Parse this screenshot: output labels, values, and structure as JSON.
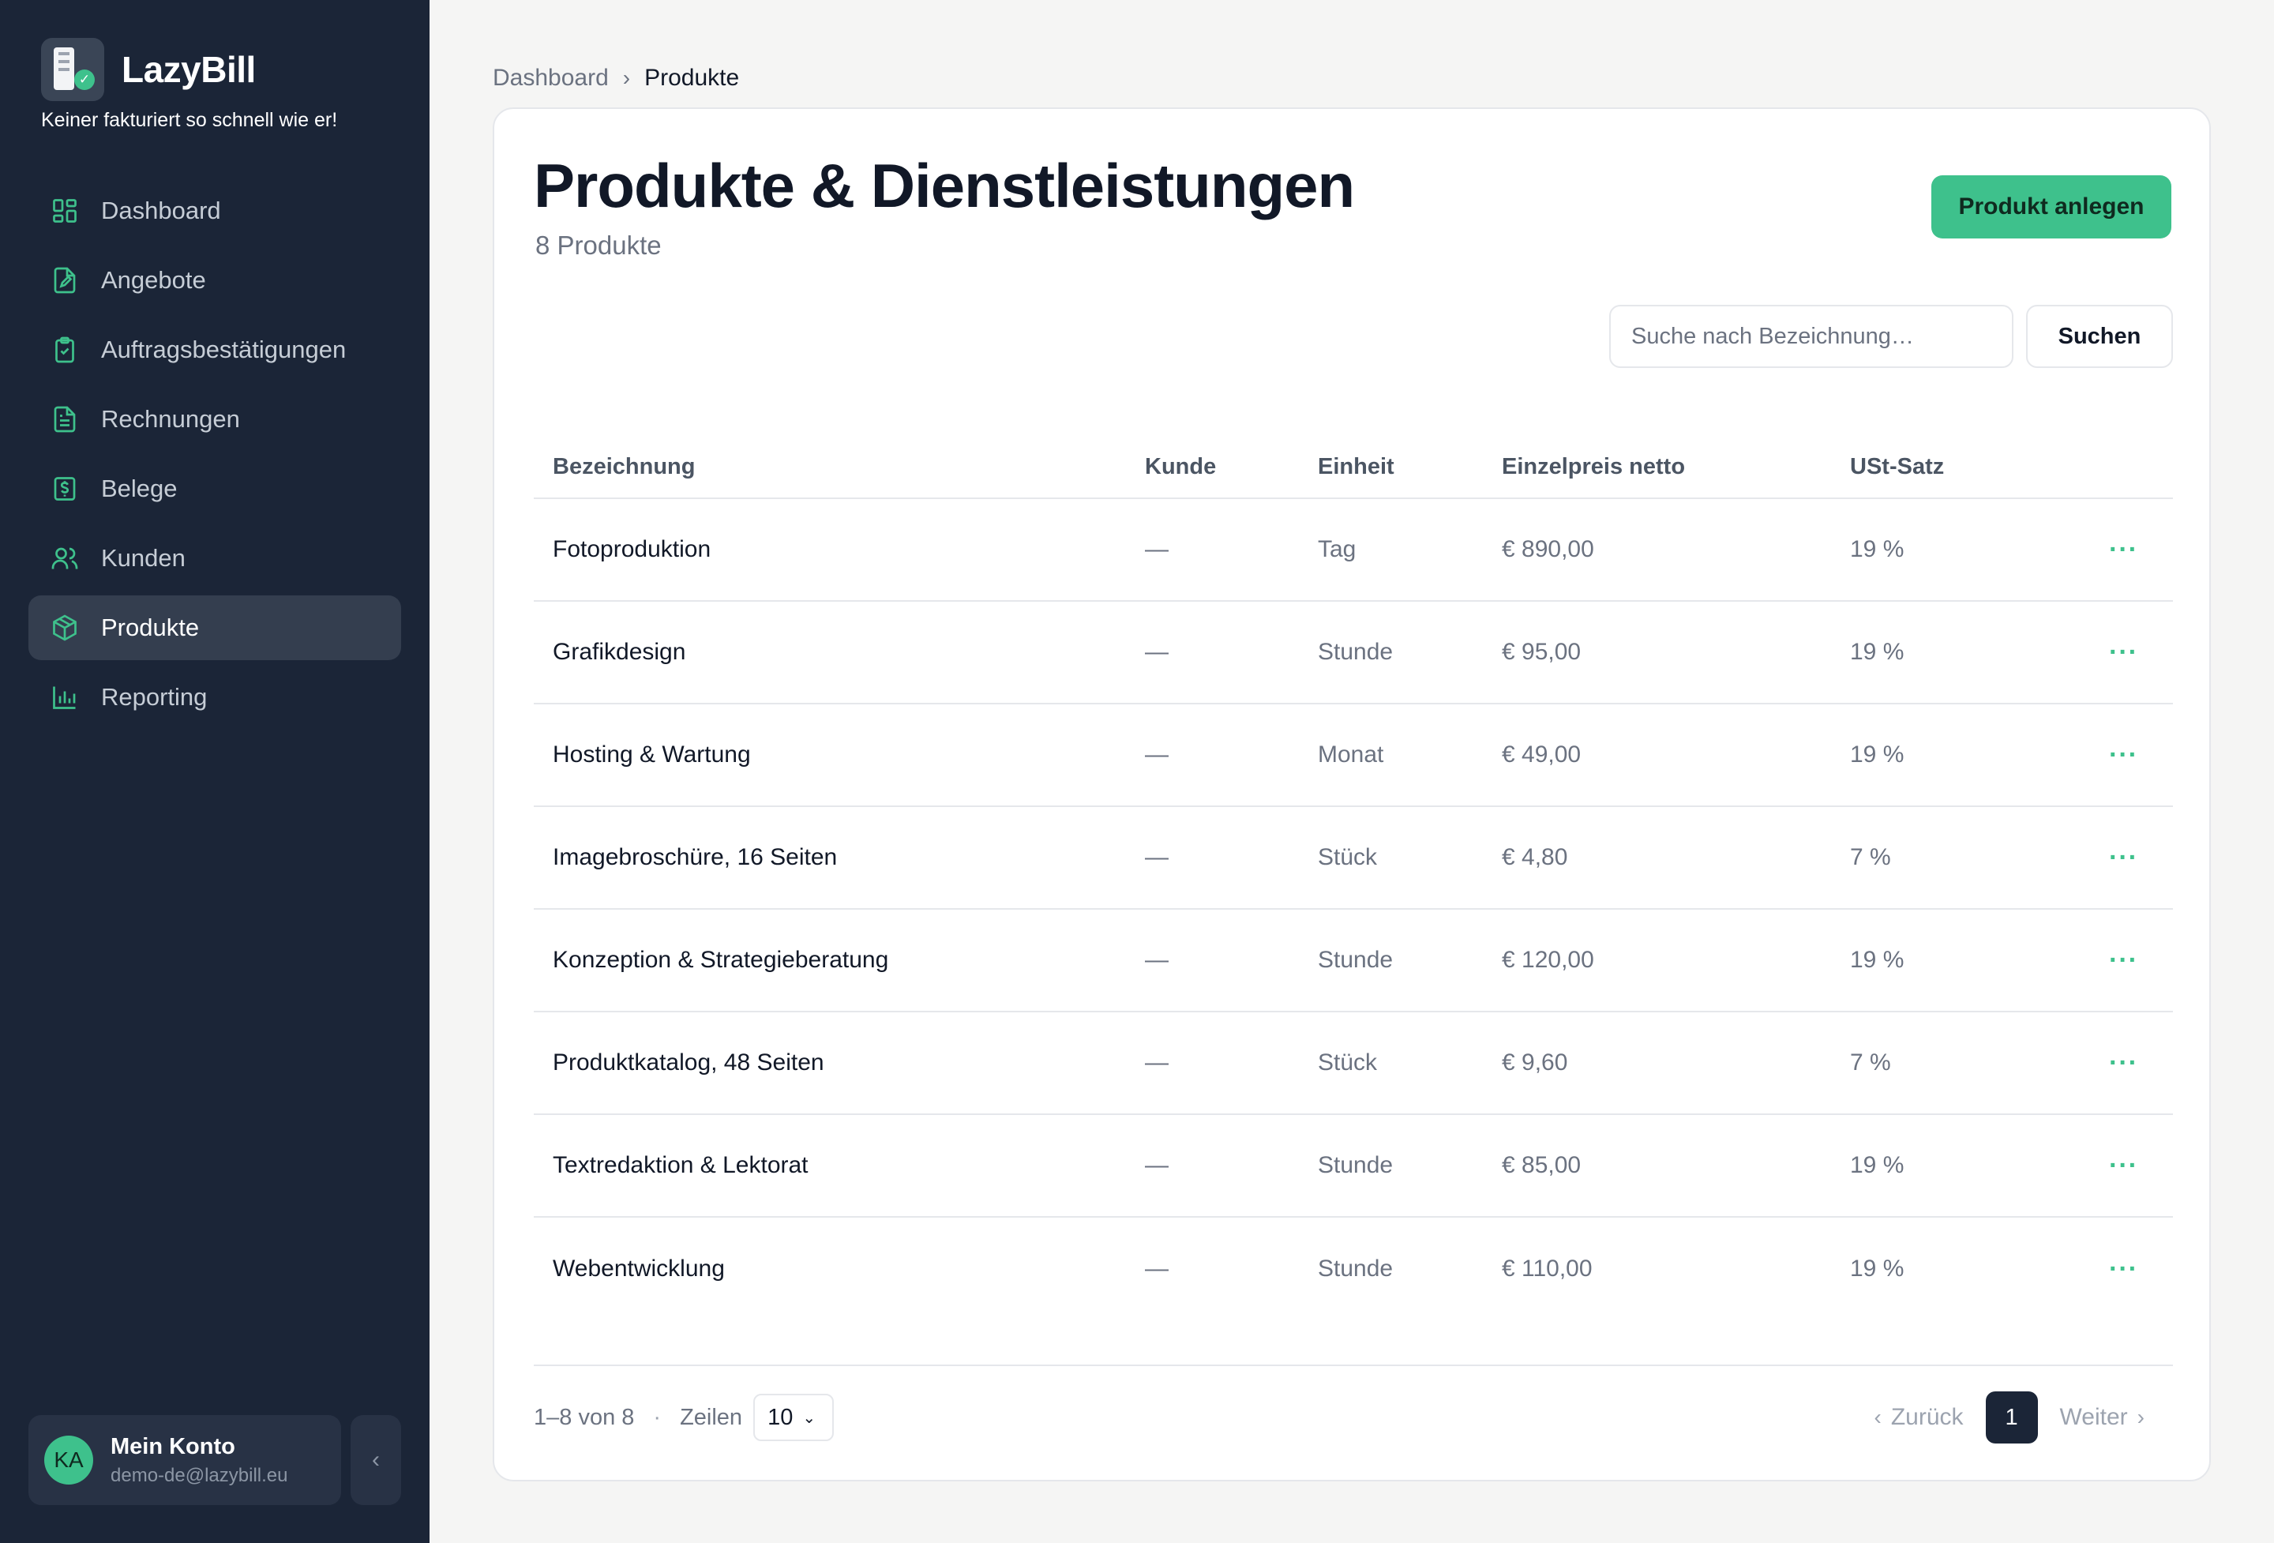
{
  "brand": {
    "name": "LazyBill",
    "tagline": "Keiner fakturiert so schnell wie er!"
  },
  "nav": [
    {
      "label": "Dashboard",
      "icon": "dashboard-icon",
      "active": false
    },
    {
      "label": "Angebote",
      "icon": "file-edit-icon",
      "active": false
    },
    {
      "label": "Auftragsbestätigungen",
      "icon": "clipboard-check-icon",
      "active": false
    },
    {
      "label": "Rechnungen",
      "icon": "file-text-icon",
      "active": false
    },
    {
      "label": "Belege",
      "icon": "receipt-icon",
      "active": false
    },
    {
      "label": "Kunden",
      "icon": "users-icon",
      "active": false
    },
    {
      "label": "Produkte",
      "icon": "box-icon",
      "active": true
    },
    {
      "label": "Reporting",
      "icon": "bar-chart-icon",
      "active": false
    }
  ],
  "account": {
    "initials": "KA",
    "name": "Mein Konto",
    "email": "demo-de@lazybill.eu"
  },
  "breadcrumb": {
    "parent": "Dashboard",
    "current": "Produkte"
  },
  "page": {
    "title": "Produkte & Dienstleistungen",
    "subtitle": "8 Produkte",
    "create_button": "Produkt anlegen",
    "search_placeholder": "Suche nach Bezeichnung…",
    "search_button": "Suchen"
  },
  "table": {
    "headers": {
      "name": "Bezeichnung",
      "kunde": "Kunde",
      "einheit": "Einheit",
      "preis": "Einzelpreis netto",
      "ust": "USt-Satz"
    },
    "rows": [
      {
        "name": "Fotoproduktion",
        "kunde": "—",
        "einheit": "Tag",
        "preis": "€ 890,00",
        "ust": "19 %"
      },
      {
        "name": "Grafikdesign",
        "kunde": "—",
        "einheit": "Stunde",
        "preis": "€ 95,00",
        "ust": "19 %"
      },
      {
        "name": "Hosting & Wartung",
        "kunde": "—",
        "einheit": "Monat",
        "preis": "€ 49,00",
        "ust": "19 %"
      },
      {
        "name": "Imagebroschüre, 16 Seiten",
        "kunde": "—",
        "einheit": "Stück",
        "preis": "€ 4,80",
        "ust": "7 %"
      },
      {
        "name": "Konzeption & Strategieberatung",
        "kunde": "—",
        "einheit": "Stunde",
        "preis": "€ 120,00",
        "ust": "19 %"
      },
      {
        "name": "Produktkatalog, 48 Seiten",
        "kunde": "—",
        "einheit": "Stück",
        "preis": "€ 9,60",
        "ust": "7 %"
      },
      {
        "name": "Textredaktion & Lektorat",
        "kunde": "—",
        "einheit": "Stunde",
        "preis": "€ 85,00",
        "ust": "19 %"
      },
      {
        "name": "Webentwicklung",
        "kunde": "—",
        "einheit": "Stunde",
        "preis": "€ 110,00",
        "ust": "19 %"
      }
    ]
  },
  "footer": {
    "range": "1–8 von 8",
    "rows_label": "Zeilen",
    "rows_value": "10",
    "prev": "Zurück",
    "page": "1",
    "next": "Weiter"
  },
  "colors": {
    "sidebar": "#1b2537",
    "accent": "#3ec18c",
    "background": "#f5f5f4"
  }
}
